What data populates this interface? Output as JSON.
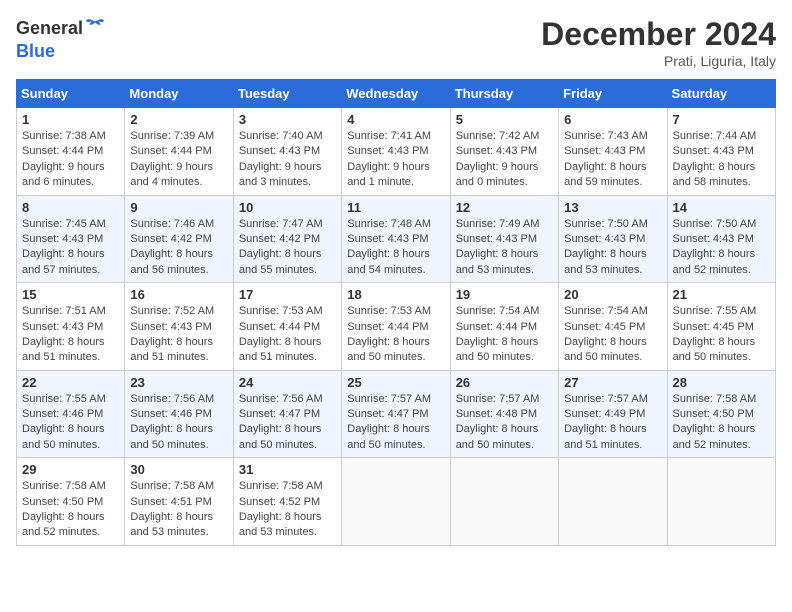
{
  "header": {
    "logo_general": "General",
    "logo_blue": "Blue",
    "title": "December 2024",
    "location": "Prati, Liguria, Italy"
  },
  "days_of_week": [
    "Sunday",
    "Monday",
    "Tuesday",
    "Wednesday",
    "Thursday",
    "Friday",
    "Saturday"
  ],
  "weeks": [
    [
      {
        "day": "1",
        "sunrise": "7:38 AM",
        "sunset": "4:44 PM",
        "daylight": "9 hours and 6 minutes."
      },
      {
        "day": "2",
        "sunrise": "7:39 AM",
        "sunset": "4:44 PM",
        "daylight": "9 hours and 4 minutes."
      },
      {
        "day": "3",
        "sunrise": "7:40 AM",
        "sunset": "4:43 PM",
        "daylight": "9 hours and 3 minutes."
      },
      {
        "day": "4",
        "sunrise": "7:41 AM",
        "sunset": "4:43 PM",
        "daylight": "9 hours and 1 minute."
      },
      {
        "day": "5",
        "sunrise": "7:42 AM",
        "sunset": "4:43 PM",
        "daylight": "9 hours and 0 minutes."
      },
      {
        "day": "6",
        "sunrise": "7:43 AM",
        "sunset": "4:43 PM",
        "daylight": "8 hours and 59 minutes."
      },
      {
        "day": "7",
        "sunrise": "7:44 AM",
        "sunset": "4:43 PM",
        "daylight": "8 hours and 58 minutes."
      }
    ],
    [
      {
        "day": "8",
        "sunrise": "7:45 AM",
        "sunset": "4:43 PM",
        "daylight": "8 hours and 57 minutes."
      },
      {
        "day": "9",
        "sunrise": "7:46 AM",
        "sunset": "4:42 PM",
        "daylight": "8 hours and 56 minutes."
      },
      {
        "day": "10",
        "sunrise": "7:47 AM",
        "sunset": "4:42 PM",
        "daylight": "8 hours and 55 minutes."
      },
      {
        "day": "11",
        "sunrise": "7:48 AM",
        "sunset": "4:43 PM",
        "daylight": "8 hours and 54 minutes."
      },
      {
        "day": "12",
        "sunrise": "7:49 AM",
        "sunset": "4:43 PM",
        "daylight": "8 hours and 53 minutes."
      },
      {
        "day": "13",
        "sunrise": "7:50 AM",
        "sunset": "4:43 PM",
        "daylight": "8 hours and 53 minutes."
      },
      {
        "day": "14",
        "sunrise": "7:50 AM",
        "sunset": "4:43 PM",
        "daylight": "8 hours and 52 minutes."
      }
    ],
    [
      {
        "day": "15",
        "sunrise": "7:51 AM",
        "sunset": "4:43 PM",
        "daylight": "8 hours and 51 minutes."
      },
      {
        "day": "16",
        "sunrise": "7:52 AM",
        "sunset": "4:43 PM",
        "daylight": "8 hours and 51 minutes."
      },
      {
        "day": "17",
        "sunrise": "7:53 AM",
        "sunset": "4:44 PM",
        "daylight": "8 hours and 51 minutes."
      },
      {
        "day": "18",
        "sunrise": "7:53 AM",
        "sunset": "4:44 PM",
        "daylight": "8 hours and 50 minutes."
      },
      {
        "day": "19",
        "sunrise": "7:54 AM",
        "sunset": "4:44 PM",
        "daylight": "8 hours and 50 minutes."
      },
      {
        "day": "20",
        "sunrise": "7:54 AM",
        "sunset": "4:45 PM",
        "daylight": "8 hours and 50 minutes."
      },
      {
        "day": "21",
        "sunrise": "7:55 AM",
        "sunset": "4:45 PM",
        "daylight": "8 hours and 50 minutes."
      }
    ],
    [
      {
        "day": "22",
        "sunrise": "7:55 AM",
        "sunset": "4:46 PM",
        "daylight": "8 hours and 50 minutes."
      },
      {
        "day": "23",
        "sunrise": "7:56 AM",
        "sunset": "4:46 PM",
        "daylight": "8 hours and 50 minutes."
      },
      {
        "day": "24",
        "sunrise": "7:56 AM",
        "sunset": "4:47 PM",
        "daylight": "8 hours and 50 minutes."
      },
      {
        "day": "25",
        "sunrise": "7:57 AM",
        "sunset": "4:47 PM",
        "daylight": "8 hours and 50 minutes."
      },
      {
        "day": "26",
        "sunrise": "7:57 AM",
        "sunset": "4:48 PM",
        "daylight": "8 hours and 50 minutes."
      },
      {
        "day": "27",
        "sunrise": "7:57 AM",
        "sunset": "4:49 PM",
        "daylight": "8 hours and 51 minutes."
      },
      {
        "day": "28",
        "sunrise": "7:58 AM",
        "sunset": "4:50 PM",
        "daylight": "8 hours and 52 minutes."
      }
    ],
    [
      {
        "day": "29",
        "sunrise": "7:58 AM",
        "sunset": "4:50 PM",
        "daylight": "8 hours and 52 minutes."
      },
      {
        "day": "30",
        "sunrise": "7:58 AM",
        "sunset": "4:51 PM",
        "daylight": "8 hours and 53 minutes."
      },
      {
        "day": "31",
        "sunrise": "7:58 AM",
        "sunset": "4:52 PM",
        "daylight": "8 hours and 53 minutes."
      },
      null,
      null,
      null,
      null
    ]
  ]
}
